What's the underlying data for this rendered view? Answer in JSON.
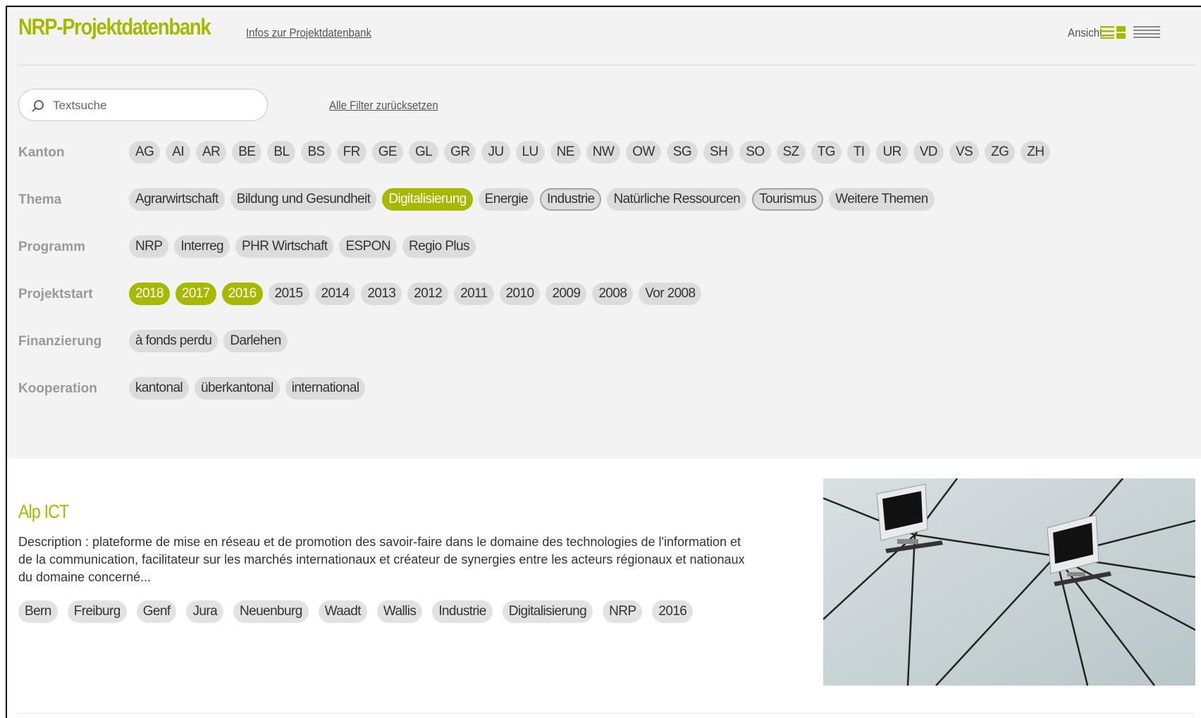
{
  "header": {
    "logo": "NRP-Projektdatenbank",
    "info_link": "Infos zur Projektdatenbank",
    "view_label": "Ansicht:",
    "view_icons": [
      "grid-list-view-icon",
      "list-view-icon"
    ],
    "accent_color": "#a6b800"
  },
  "search": {
    "placeholder": "Textsuche",
    "value": "",
    "reset_label": "Alle Filter zurücksetzen"
  },
  "filters": {
    "kanton": {
      "label": "Kanton",
      "options": [
        {
          "label": "AG"
        },
        {
          "label": "AI"
        },
        {
          "label": "AR"
        },
        {
          "label": "BE"
        },
        {
          "label": "BL"
        },
        {
          "label": "BS"
        },
        {
          "label": "FR"
        },
        {
          "label": "GE"
        },
        {
          "label": "GL"
        },
        {
          "label": "GR"
        },
        {
          "label": "JU"
        },
        {
          "label": "LU"
        },
        {
          "label": "NE"
        },
        {
          "label": "NW"
        },
        {
          "label": "OW"
        },
        {
          "label": "SG"
        },
        {
          "label": "SH"
        },
        {
          "label": "SO"
        },
        {
          "label": "SZ"
        },
        {
          "label": "TG"
        },
        {
          "label": "TI"
        },
        {
          "label": "UR"
        },
        {
          "label": "VD"
        },
        {
          "label": "VS"
        },
        {
          "label": "ZG"
        },
        {
          "label": "ZH"
        }
      ]
    },
    "thema": {
      "label": "Thema",
      "options": [
        {
          "label": "Agrarwirtschaft"
        },
        {
          "label": "Bildung und Gesundheit"
        },
        {
          "label": "Digitalisierung",
          "state": "active"
        },
        {
          "label": "Energie"
        },
        {
          "label": "Industrie",
          "state": "outlined"
        },
        {
          "label": "Natürliche Ressourcen"
        },
        {
          "label": "Tourismus",
          "state": "outlined"
        },
        {
          "label": "Weitere Themen"
        }
      ]
    },
    "programm": {
      "label": "Programm",
      "options": [
        {
          "label": "NRP"
        },
        {
          "label": "Interreg"
        },
        {
          "label": "PHR Wirtschaft"
        },
        {
          "label": "ESPON"
        },
        {
          "label": "Regio Plus"
        }
      ]
    },
    "projektstart": {
      "label": "Projektstart",
      "options": [
        {
          "label": "2018",
          "state": "active"
        },
        {
          "label": "2017",
          "state": "active"
        },
        {
          "label": "2016",
          "state": "active"
        },
        {
          "label": "2015"
        },
        {
          "label": "2014"
        },
        {
          "label": "2013"
        },
        {
          "label": "2012"
        },
        {
          "label": "2011"
        },
        {
          "label": "2010"
        },
        {
          "label": "2009"
        },
        {
          "label": "2008"
        },
        {
          "label": "Vor 2008"
        }
      ]
    },
    "finanzierung": {
      "label": "Finanzierung",
      "options": [
        {
          "label": "à fonds perdu"
        },
        {
          "label": "Darlehen"
        }
      ]
    },
    "kooperation": {
      "label": "Kooperation",
      "options": [
        {
          "label": "kantonal"
        },
        {
          "label": "überkantonal"
        },
        {
          "label": "international"
        }
      ]
    }
  },
  "result": {
    "title": "Alp ICT",
    "description": "Description : plateforme de mise en réseau et de promotion des savoir-faire dans le domaine des technologies de l'information et de la communication, facilitateur sur les marchés internationaux et créateur de synergies entre les acteurs régionaux et nationaux du domaine concerné...",
    "tags": [
      "Bern",
      "Freiburg",
      "Genf",
      "Jura",
      "Neuenburg",
      "Waadt",
      "Wallis",
      "Industrie",
      "Digitalisierung",
      "NRP",
      "2016"
    ]
  }
}
